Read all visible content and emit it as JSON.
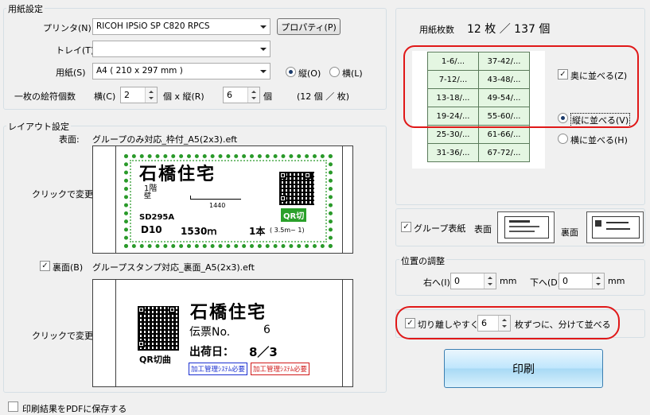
{
  "paper_settings": {
    "title": "用紙設定",
    "printer_label": "プリンタ(N)",
    "printer_value": "RICOH IPSiO SP C820 RPCS",
    "property_button": "プロパティ(P)",
    "tray_label": "トレイ(T)",
    "tray_value": "",
    "paper_label": "用紙(S)",
    "paper_value": "A4 ( 210 x 297 mm )",
    "portrait_label": "縦(O)",
    "landscape_label": "横(L)",
    "orientation": "portrait",
    "tags_per_sheet_label": "一枚の絵符個数",
    "horizontal_label": "横(C)",
    "horizontal_value": "2",
    "mid_label": "個 x 縦(R)",
    "vertical_value": "6",
    "unit_label": "個",
    "total_label": "(12 個 ／ 枚)"
  },
  "layout_settings": {
    "title": "レイアウト設定",
    "front_label": "表面:",
    "front_file": "グループのみ対応_枠付_A5(2x3).eft",
    "click_to_change": "クリックで変更",
    "back_checkbox_label": "裏面(B)",
    "back_checked": true,
    "back_file": "グループスタンプ対応_裏面_A5(2x3).eft"
  },
  "front_preview": {
    "company": "石橋住宅",
    "floor": "1階",
    "sub": "壁",
    "dimension": "1440",
    "code": "SD295A",
    "diameter": "D10",
    "length": "1530ｍ",
    "count": "1本",
    "range": "( 3.5m~    1)",
    "qr_badge": "QR切"
  },
  "back_preview": {
    "company": "石橋住宅",
    "slip_label": "伝票No.",
    "slip_value": "6",
    "ship_label": "出荷日：",
    "ship_value": "8／3",
    "qr_caption": "QR切曲",
    "stamp_blue": "加工管理ｼｽﾃﾑ必要",
    "stamp_red": "加工管理ｼｽﾃﾑ必要"
  },
  "pdf_checkbox_label": "印刷結果をPDFに保存する",
  "pdf_checked": false,
  "sheet_count": {
    "label": "用紙枚数",
    "text": "12 枚 ／ 137 個"
  },
  "grid_cells": [
    [
      "1-6/...",
      "37-42/..."
    ],
    [
      "7-12/...",
      "43-48/..."
    ],
    [
      "13-18/...",
      "49-54/..."
    ],
    [
      "19-24/...",
      "55-60/..."
    ],
    [
      "25-30/...",
      "61-66/..."
    ],
    [
      "31-36/...",
      "67-72/..."
    ]
  ],
  "arrange": {
    "back_checkbox": "奥に並べる(Z)",
    "back_checked": true,
    "vertical_radio": "縦に並べる(V)",
    "horizontal_radio": "横に並べる(H)",
    "selected": "vertical"
  },
  "group_cover": {
    "checkbox_label": "グループ表紙",
    "checked": true,
    "front_label": "表面",
    "back_label": "裏面"
  },
  "position_adjust": {
    "title": "位置の調整",
    "right_label": "右へ(I)",
    "right_value": "0",
    "down_label": "下へ(D)",
    "down_value": "0",
    "unit": "mm"
  },
  "separate": {
    "checkbox_label": "切り離しやすく",
    "checked": true,
    "value": "6",
    "suffix": "枚ずつに、分けて並べる"
  },
  "print_button": "印刷",
  "colors": {
    "highlight_red": "#e01818",
    "grid_green": "#e4f6e2",
    "qr_badge_green": "#2aa02a"
  }
}
